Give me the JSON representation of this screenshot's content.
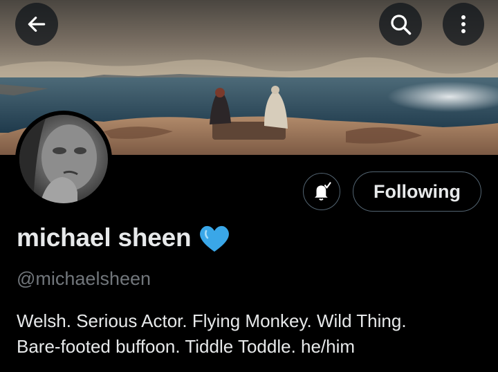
{
  "header": {
    "back_icon": "arrow-left-icon",
    "search_icon": "search-icon",
    "more_icon": "more-vertical-icon"
  },
  "profile": {
    "display_name": "michael sheen",
    "name_emoji": "blue-heart-emoji",
    "handle": "@michaelsheen",
    "bio_line1": "Welsh. Serious Actor. Flying Monkey. Wild Thing.",
    "bio_line2": "Bare-footed buffoon. Tiddle Toddle. he/him"
  },
  "actions": {
    "notification_icon": "bell-subscribed-icon",
    "follow_label": "Following"
  },
  "colors": {
    "background": "#000000",
    "text": "#e7e9ea",
    "secondary_text": "#71767b",
    "button_border": "#536471",
    "heart": "#3aa7e8"
  }
}
